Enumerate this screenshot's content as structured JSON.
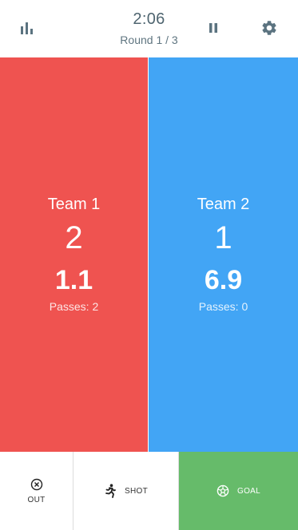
{
  "header": {
    "clock": "2:06",
    "round": "Round 1 / 3",
    "icons": {
      "stats": "bar-chart-icon",
      "pause": "pause-icon",
      "settings": "gear-icon"
    },
    "icon_color": "#5b7380"
  },
  "teams": [
    {
      "name": "Team 1",
      "score": "2",
      "rating": "1.1",
      "passes": "Passes: 2",
      "color": "#ef5350"
    },
    {
      "name": "Team 2",
      "score": "1",
      "rating": "6.9",
      "passes": "Passes: 0",
      "color": "#42a5f5"
    }
  ],
  "actions": {
    "out": {
      "label": "OUT",
      "icon": "circle-x-icon"
    },
    "shot": {
      "label": "SHOT",
      "icon": "running-person-icon"
    },
    "goal": {
      "label": "GOAL",
      "icon": "soccer-ball-icon",
      "color": "#66bb6a"
    }
  }
}
